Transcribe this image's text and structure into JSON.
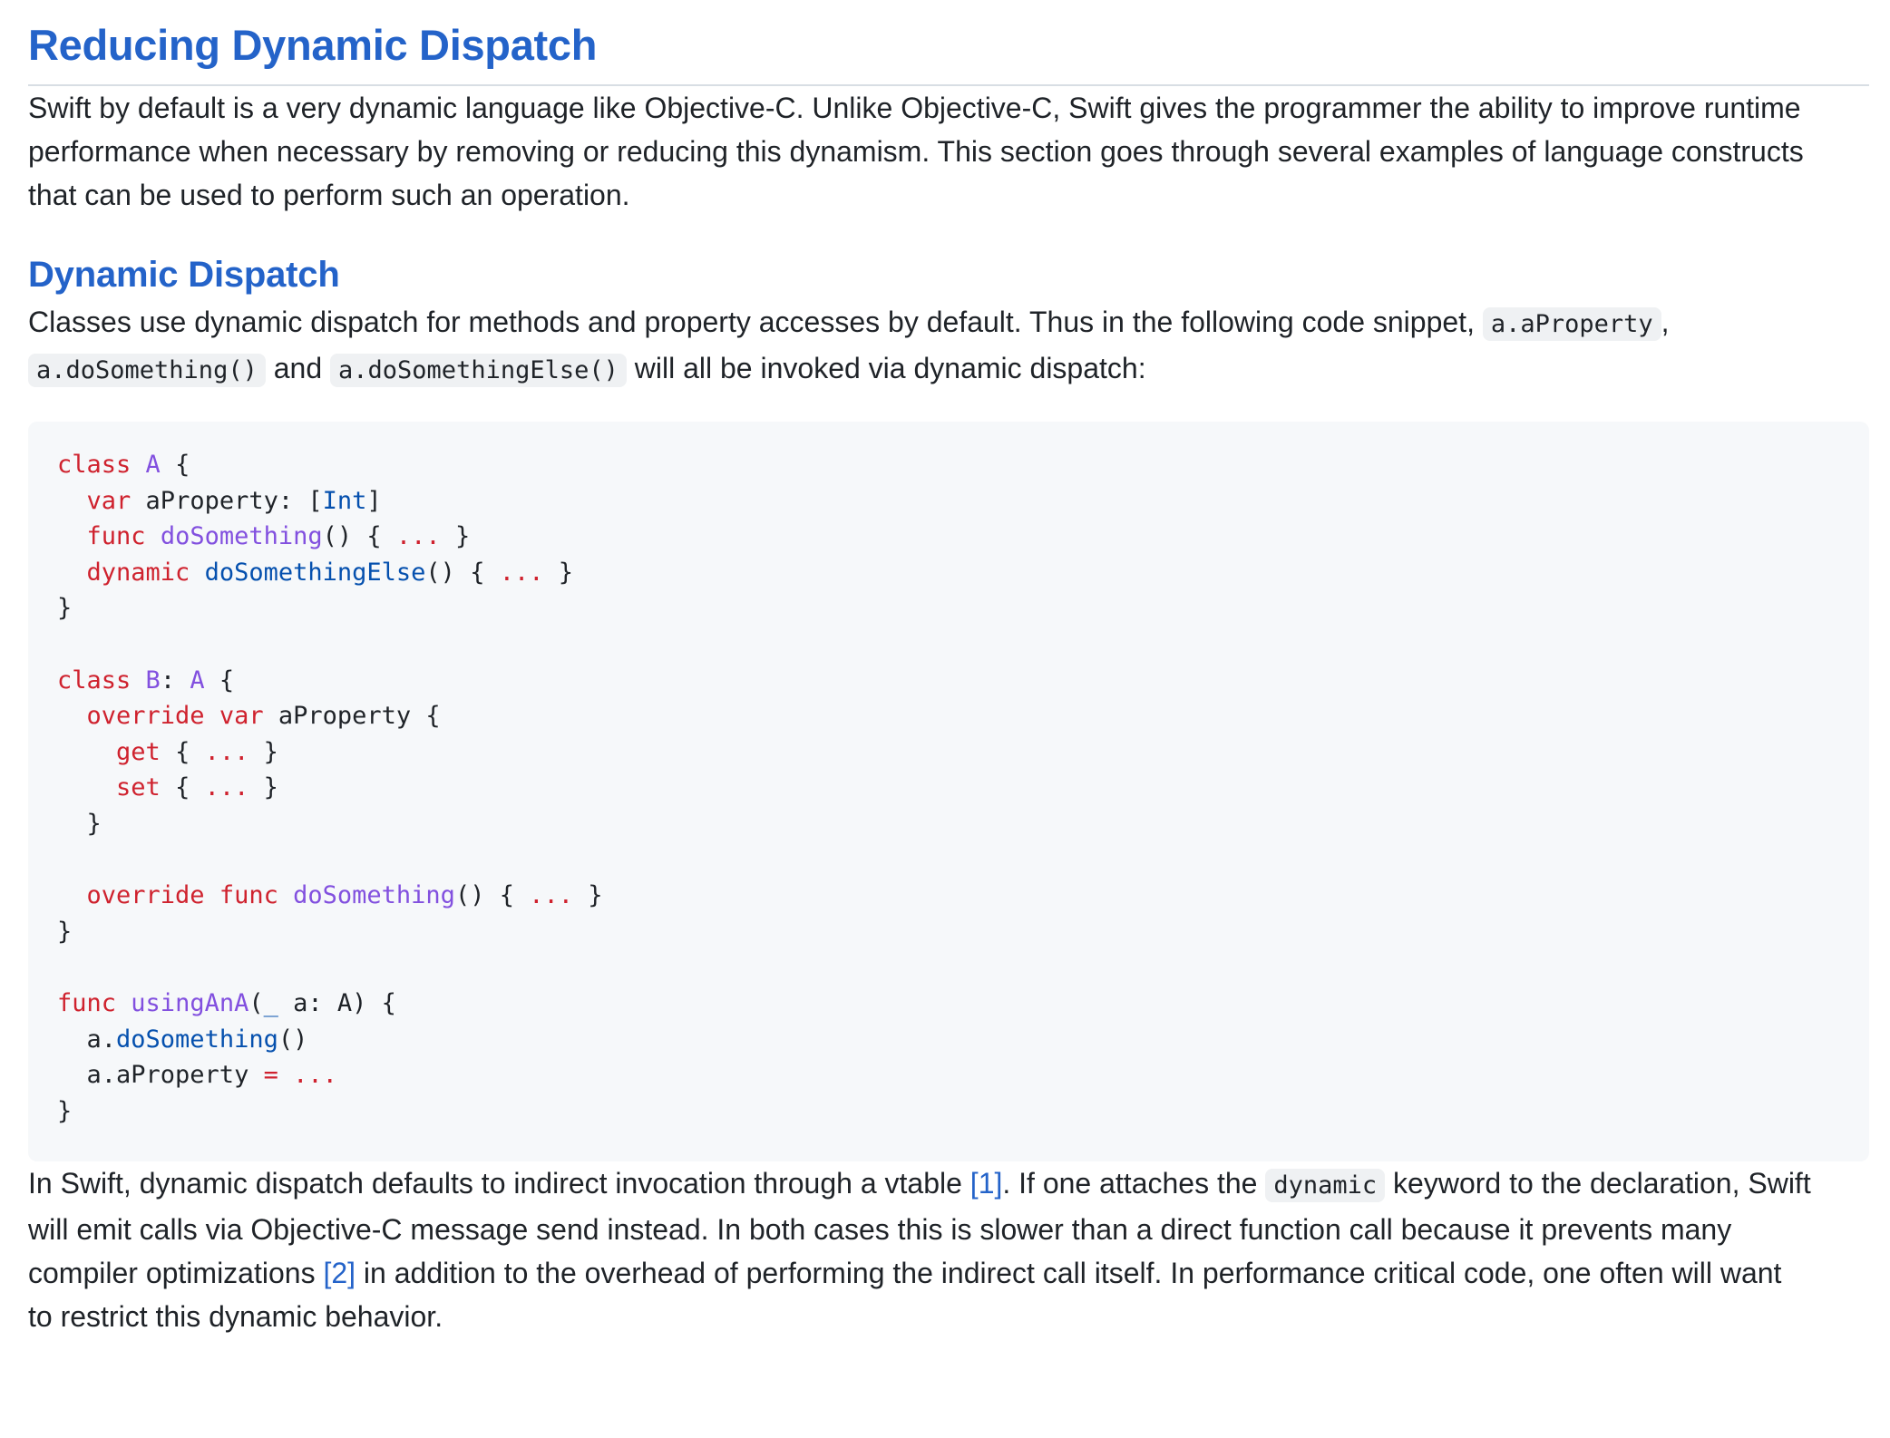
{
  "title": "Reducing Dynamic Dispatch",
  "intro": {
    "lines": [
      "Swift by default is a very dynamic language like Objective-C. Unlike Objective-C, Swift gives the programmer the ability to improve runtime",
      "performance when necessary by removing or reducing this dynamism. This section goes through several examples of language constructs",
      "that can be used to perform such an operation."
    ]
  },
  "section": {
    "heading": "Dynamic Dispatch",
    "para": {
      "t1": "Classes use dynamic dispatch for methods and property accesses by default. Thus in the following code snippet,",
      "c1": "a.aProperty",
      "t2": ",",
      "c2": "a.doSomething()",
      "t3": "and",
      "c3": "a.doSomethingElse()",
      "t4": "will all be invoked via dynamic dispatch:"
    },
    "code_lines": [
      "class A {",
      "  var aProperty: [Int]",
      "  func doSomething() { ... }",
      "  dynamic doSomethingElse() { ... }",
      "}",
      "",
      "class B: A {",
      "  override var aProperty {",
      "    get { ... }",
      "    set { ... }",
      "  }",
      "",
      "  override func doSomething() { ... }",
      "}",
      "",
      "func usingAnA(_ a: A) {",
      "  a.doSomething()",
      "  a.aProperty = ...",
      "}"
    ],
    "after": {
      "l1a": "In Swift, dynamic dispatch defaults to indirect invocation through a vtable",
      "ref1": "[1]",
      "l1b": ". If one attaches the",
      "code": "dynamic",
      "l1c": "keyword to the declaration, Swift",
      "l2": "will emit calls via Objective-C message send instead. In both cases this is slower than a direct function call because it prevents many",
      "l3a": "compiler optimizations",
      "ref2": "[2]",
      "l3b": "in addition to the overhead of performing the indirect call itself. In performance critical code, one often will want",
      "l4": "to restrict this dynamic behavior."
    }
  },
  "colors": {
    "heading": "#2463c9",
    "keyword": "#cf222e",
    "type": "#8250df",
    "code_bg": "#f6f8fa",
    "inline_code_bg": "#eff1f3"
  }
}
